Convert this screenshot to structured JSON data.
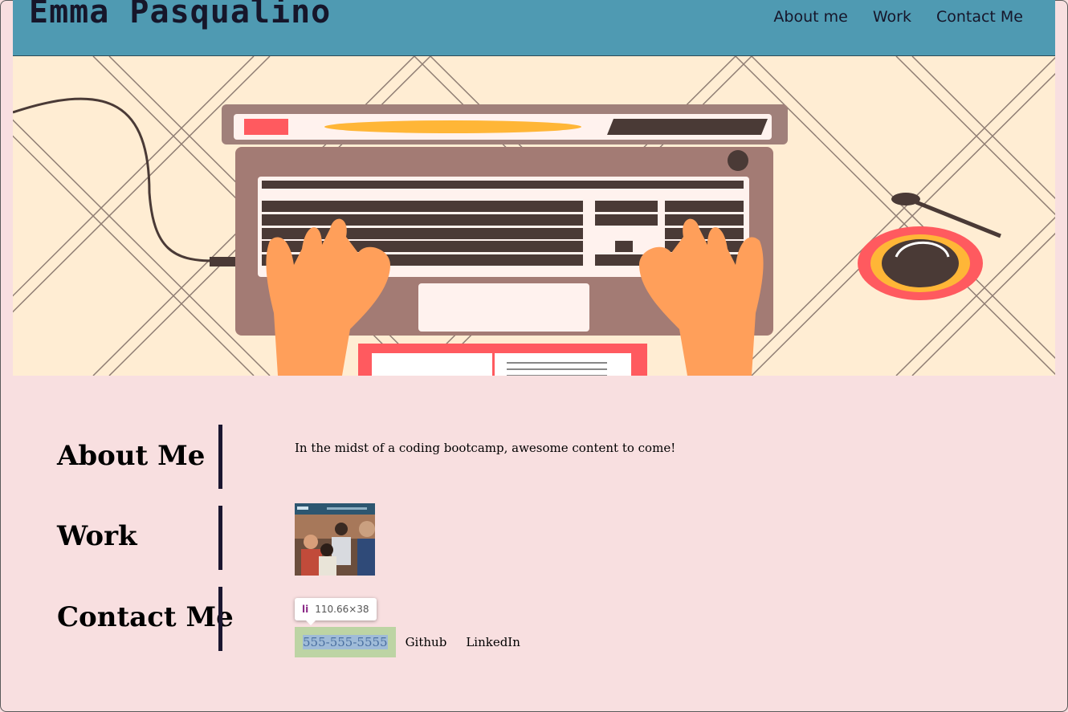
{
  "header": {
    "title": "Emma Pasqualino",
    "nav": [
      "About me",
      "Work",
      "Contact Me"
    ]
  },
  "sections": {
    "about": {
      "title": "About Me",
      "text": "In the midst of a coding bootcamp, awesome content to come!"
    },
    "work": {
      "title": "Work"
    },
    "contact": {
      "title": "Contact Me",
      "items": [
        "555-555-5555",
        "Github",
        "LinkedIn"
      ]
    }
  },
  "inspector_tooltip": {
    "tag": "li",
    "size": "110.66×38"
  },
  "colors": {
    "header": "#4f9ab2",
    "page": "#f8dfe0",
    "highlight": "#bdd4a4"
  }
}
